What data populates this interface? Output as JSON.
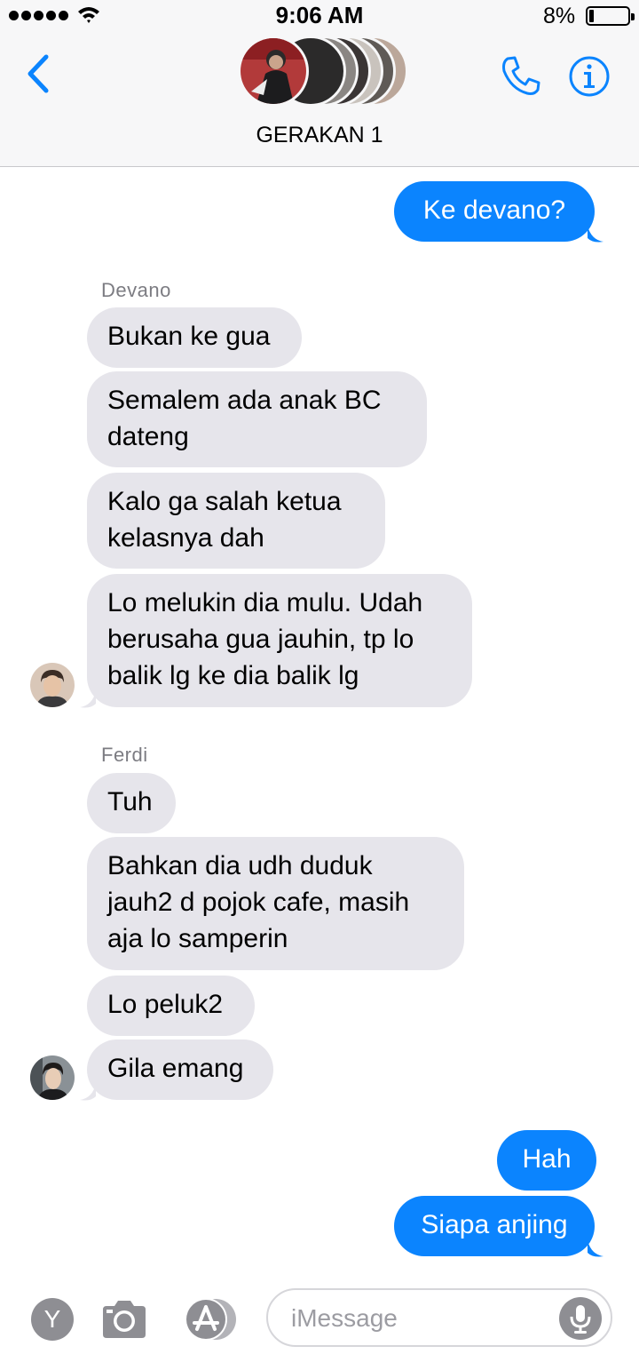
{
  "status_bar": {
    "time": "9:06 AM",
    "battery_percent": "8%",
    "battery_level": 0.08,
    "signal_bars": 5
  },
  "header": {
    "back_icon": "chevron-left-icon",
    "group_name": "GERAKAN 1",
    "call_icon": "phone-icon",
    "info_icon": "info-circle-icon",
    "accent_color": "#0b84fe"
  },
  "messages": [
    {
      "side": "out",
      "text": "Ke devano?"
    },
    {
      "side": "in",
      "sender": "Devano",
      "text": "Bukan ke gua"
    },
    {
      "side": "in",
      "text": "Semalem ada anak BC dateng"
    },
    {
      "side": "in",
      "text": "Kalo ga salah ketua kelasnya dah"
    },
    {
      "side": "in",
      "text": "Lo melukin dia mulu. Udah berusaha gua jauhin, tp lo balik lg ke dia balik lg"
    },
    {
      "side": "in",
      "sender": "Ferdi",
      "text": "Tuh"
    },
    {
      "side": "in",
      "text": "Bahkan dia udh duduk jauh2 d pojok cafe, masih aja lo samperin"
    },
    {
      "side": "in",
      "text": "Lo peluk2"
    },
    {
      "side": "in",
      "text": "Gila emang"
    },
    {
      "side": "out",
      "text": "Hah"
    },
    {
      "side": "out",
      "text": "Siapa anjing"
    }
  ],
  "input_bar": {
    "app_y_label": "Y",
    "camera_icon": "camera-icon",
    "appstore_icon": "app-store-icon",
    "placeholder": "iMessage",
    "mic_icon": "microphone-icon"
  },
  "colors": {
    "incoming_bubble": "#e6e5eb",
    "outgoing_bubble": "#0b84fe",
    "sender_label": "#7c7c82"
  }
}
